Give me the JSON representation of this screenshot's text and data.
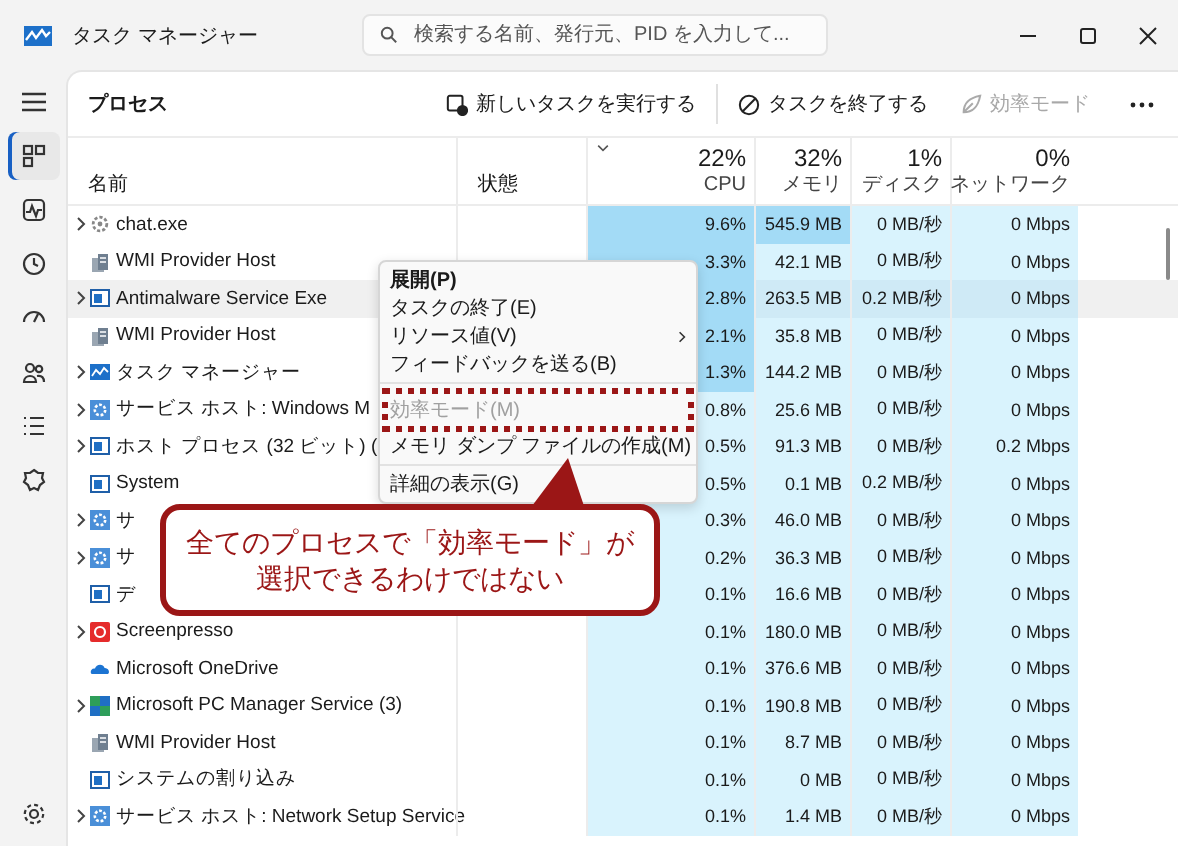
{
  "window": {
    "title": "タスク マネージャー"
  },
  "search": {
    "placeholder": "検索する名前、発行元、PID を入力して..."
  },
  "sidebar": {
    "items": [
      {
        "kind": "processes",
        "selected": true
      },
      {
        "kind": "performance",
        "selected": false
      },
      {
        "kind": "history",
        "selected": false
      },
      {
        "kind": "startup",
        "selected": false
      },
      {
        "kind": "users",
        "selected": false
      },
      {
        "kind": "details",
        "selected": false
      },
      {
        "kind": "services",
        "selected": false
      }
    ]
  },
  "page_title": "プロセス",
  "toolbar": [
    {
      "kind": "run",
      "label": "新しいタスクを実行する",
      "disabled": false
    },
    {
      "kind": "end",
      "label": "タスクを終了する",
      "disabled": false
    },
    {
      "kind": "efficiency",
      "label": "効率モード",
      "disabled": true
    }
  ],
  "table": {
    "columns": [
      {
        "label": "名前"
      },
      {
        "label": "状態"
      },
      {
        "total": "22%",
        "label": "CPU",
        "sorted": true
      },
      {
        "total": "32%",
        "label": "メモリ",
        "sorted": false
      },
      {
        "total": "1%",
        "label": "ディスク",
        "sorted": false
      },
      {
        "total": "0%",
        "label": "ネットワーク",
        "sorted": false
      }
    ],
    "rows": [
      {
        "name": "chat.exe",
        "kind": "gear",
        "expandable": true,
        "hovered": false,
        "cpu": "9.6%",
        "memory": "545.9 MB",
        "disk": "0 MB/秒",
        "network": "0 Mbps",
        "cpu_hot": true,
        "memory_hot": true
      },
      {
        "name": "WMI Provider Host",
        "kind": "server",
        "expandable": false,
        "hovered": false,
        "cpu": "3.3%",
        "memory": "42.1 MB",
        "disk": "0 MB/秒",
        "network": "0 Mbps",
        "cpu_hot": true,
        "memory_hot": false
      },
      {
        "name": "Antimalware Service Exe",
        "kind": "window",
        "expandable": true,
        "hovered": true,
        "cpu": "2.8%",
        "memory": "263.5 MB",
        "disk": "0.2 MB/秒",
        "network": "0 Mbps",
        "cpu_hot": true,
        "memory_hot": false
      },
      {
        "name": "WMI Provider Host",
        "kind": "server",
        "expandable": false,
        "hovered": false,
        "cpu": "2.1%",
        "memory": "35.8 MB",
        "disk": "0 MB/秒",
        "network": "0 Mbps",
        "cpu_hot": true,
        "memory_hot": false
      },
      {
        "name": "タスク マネージャー",
        "kind": "chart",
        "expandable": true,
        "hovered": false,
        "cpu": "1.3%",
        "memory": "144.2 MB",
        "disk": "0 MB/秒",
        "network": "0 Mbps",
        "cpu_hot": true,
        "memory_hot": false
      },
      {
        "name": "サービス ホスト: Windows M",
        "kind": "service",
        "expandable": true,
        "hovered": false,
        "cpu": "0.8%",
        "memory": "25.6 MB",
        "disk": "0 MB/秒",
        "network": "0 Mbps",
        "cpu_hot": false,
        "memory_hot": false
      },
      {
        "name": "ホスト プロセス (32 ビット) (",
        "kind": "window",
        "expandable": true,
        "hovered": false,
        "cpu": "0.5%",
        "memory": "91.3 MB",
        "disk": "0 MB/秒",
        "network": "0.2 Mbps",
        "cpu_hot": false,
        "memory_hot": false
      },
      {
        "name": "System",
        "kind": "window",
        "expandable": false,
        "hovered": false,
        "cpu": "0.5%",
        "memory": "0.1 MB",
        "disk": "0.2 MB/秒",
        "network": "0 Mbps",
        "cpu_hot": false,
        "memory_hot": false
      },
      {
        "name": "サ",
        "kind": "service",
        "expandable": true,
        "hovered": false,
        "cpu": "0.3%",
        "memory": "46.0 MB",
        "disk": "0 MB/秒",
        "network": "0 Mbps",
        "cpu_hot": false,
        "memory_hot": false
      },
      {
        "name": "サ",
        "kind": "service",
        "expandable": true,
        "hovered": false,
        "cpu": "0.2%",
        "memory": "36.3 MB",
        "disk": "0 MB/秒",
        "network": "0 Mbps",
        "cpu_hot": false,
        "memory_hot": false
      },
      {
        "name": "デ",
        "kind": "window",
        "expandable": false,
        "hovered": false,
        "cpu": "0.1%",
        "memory": "16.6 MB",
        "disk": "0 MB/秒",
        "network": "0 Mbps",
        "cpu_hot": false,
        "memory_hot": false
      },
      {
        "name": "Screenpresso",
        "kind": "red-app",
        "expandable": true,
        "hovered": false,
        "cpu": "0.1%",
        "memory": "180.0 MB",
        "disk": "0 MB/秒",
        "network": "0 Mbps",
        "cpu_hot": false,
        "memory_hot": false
      },
      {
        "name": "Microsoft OneDrive",
        "kind": "cloud",
        "expandable": false,
        "hovered": false,
        "cpu": "0.1%",
        "memory": "376.6 MB",
        "disk": "0 MB/秒",
        "network": "0 Mbps",
        "cpu_hot": false,
        "memory_hot": false
      },
      {
        "name": "Microsoft PC Manager Service (3)",
        "kind": "pc-manager",
        "expandable": true,
        "hovered": false,
        "cpu": "0.1%",
        "memory": "190.8 MB",
        "disk": "0 MB/秒",
        "network": "0 Mbps",
        "cpu_hot": false,
        "memory_hot": false
      },
      {
        "name": "WMI Provider Host",
        "kind": "server",
        "expandable": false,
        "hovered": false,
        "cpu": "0.1%",
        "memory": "8.7 MB",
        "disk": "0 MB/秒",
        "network": "0 Mbps",
        "cpu_hot": false,
        "memory_hot": false
      },
      {
        "name": "システムの割り込み",
        "kind": "window",
        "expandable": false,
        "hovered": false,
        "cpu": "0.1%",
        "memory": "0 MB",
        "disk": "0 MB/秒",
        "network": "0 Mbps",
        "cpu_hot": false,
        "memory_hot": false
      },
      {
        "name": "サービス ホスト: Network Setup Service",
        "kind": "service",
        "expandable": true,
        "hovered": false,
        "cpu": "0.1%",
        "memory": "1.4 MB",
        "disk": "0 MB/秒",
        "network": "0 Mbps",
        "cpu_hot": false,
        "memory_hot": false
      }
    ]
  },
  "context_menu": {
    "items": [
      {
        "kind": "item",
        "label": "展開(P)",
        "default": true,
        "disabled": false,
        "submenu": false,
        "annotated": false
      },
      {
        "kind": "item",
        "label": "タスクの終了(E)",
        "default": false,
        "disabled": false,
        "submenu": false,
        "annotated": false
      },
      {
        "kind": "item",
        "label": "リソース値(V)",
        "default": false,
        "disabled": false,
        "submenu": true,
        "annotated": false
      },
      {
        "kind": "item",
        "label": "フィードバックを送る(B)",
        "default": false,
        "disabled": false,
        "submenu": false,
        "annotated": false
      },
      {
        "kind": "separator"
      },
      {
        "kind": "item",
        "label": "効率モード(M)",
        "default": false,
        "disabled": true,
        "submenu": false,
        "annotated": true
      },
      {
        "kind": "item",
        "label": "メモリ ダンプ ファイルの作成(M)",
        "default": false,
        "disabled": false,
        "submenu": false,
        "annotated": false
      },
      {
        "kind": "separator"
      },
      {
        "kind": "item",
        "label": "詳細の表示(G)",
        "default": false,
        "disabled": false,
        "submenu": false,
        "annotated": false
      }
    ]
  },
  "callout": {
    "text": "全てのプロセスで「効率モード」が選択できるわけではない"
  }
}
